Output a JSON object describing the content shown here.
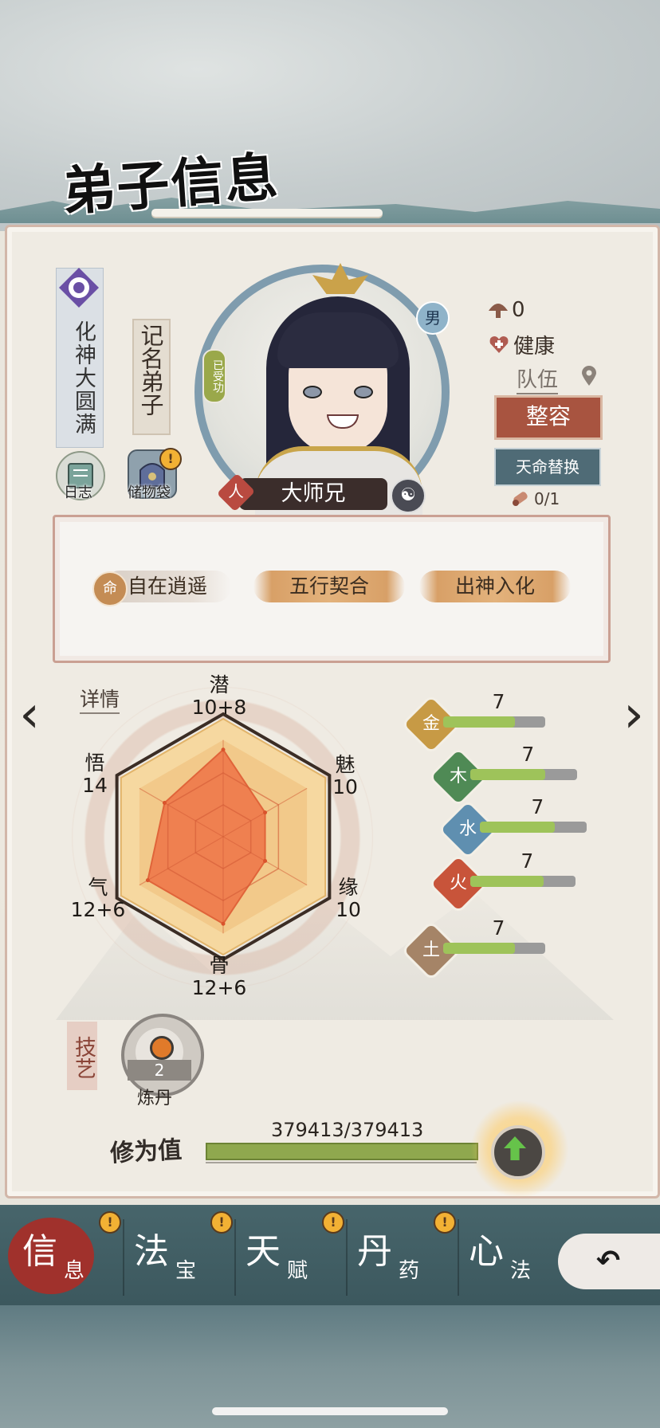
{
  "header": {
    "title": "弟子信息"
  },
  "disciple": {
    "realm": "化神大圆满",
    "rank_tag": "记名弟子",
    "name": "大师兄",
    "gender": "男",
    "race": "人",
    "oath_status": "已受功",
    "shortcuts": [
      {
        "label": "日志",
        "icon": "journal-icon"
      },
      {
        "label": "储物袋",
        "icon": "storage-bag-icon",
        "alert": "!"
      }
    ],
    "mushroom_count": "0",
    "health": "健康",
    "team_label": "队伍",
    "appearance_button": "整容",
    "fate_swap_button": "天命替换",
    "fate_scroll_count": "0/1"
  },
  "traits": [
    {
      "label": "自在逍遥",
      "icon_text": "命"
    },
    {
      "label": "五行契合"
    },
    {
      "label": "出神入化"
    }
  ],
  "stats_link": "详情",
  "radar": {
    "潜": {
      "name": "潜",
      "value": "10+8"
    },
    "魅": {
      "name": "魅",
      "value": "10"
    },
    "缘": {
      "name": "缘",
      "value": "10"
    },
    "骨": {
      "name": "骨",
      "value": "12+6"
    },
    "气": {
      "name": "气",
      "value": "12+6"
    },
    "悟": {
      "name": "悟",
      "value": "14"
    }
  },
  "chart_data": {
    "type": "radar",
    "categories": [
      "潜",
      "魅",
      "缘",
      "骨",
      "气",
      "悟"
    ],
    "values": [
      18,
      10,
      10,
      18,
      18,
      14
    ],
    "ylim": [
      0,
      20
    ]
  },
  "elements": [
    {
      "name": "金",
      "value": "7",
      "fill": 0.7,
      "color": "#c79a45"
    },
    {
      "name": "木",
      "value": "7",
      "fill": 0.7,
      "color": "#4f8a55"
    },
    {
      "name": "水",
      "value": "7",
      "fill": 0.7,
      "color": "#5f8fb0"
    },
    {
      "name": "火",
      "value": "7",
      "fill": 0.7,
      "color": "#c8543a"
    },
    {
      "name": "土",
      "value": "7",
      "fill": 0.7,
      "color": "#a58467"
    }
  ],
  "skills": {
    "tab_label": "技艺",
    "items": [
      {
        "name": "炼丹",
        "level": "2"
      }
    ]
  },
  "cultivation": {
    "label": "修为值",
    "value": "379413/379413",
    "fill": 1.0
  },
  "tabs": [
    {
      "big": "信",
      "small": "息",
      "active": true,
      "alert": "!"
    },
    {
      "big": "法",
      "small": "宝",
      "alert": "!"
    },
    {
      "big": "天",
      "small": "赋",
      "alert": "!"
    },
    {
      "big": "丹",
      "small": "药",
      "alert": "!"
    },
    {
      "big": "心",
      "small": "法"
    }
  ],
  "colors": {
    "accent_red": "#a0312c",
    "radar_fill": "#ef8050",
    "tab_bg": "#47656b"
  }
}
